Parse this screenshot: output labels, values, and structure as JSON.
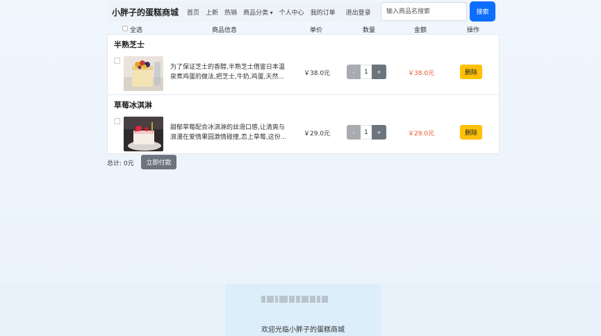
{
  "nav": {
    "brand": "小胖子的蛋糕商城",
    "links": [
      "首页",
      "上新",
      "热销"
    ],
    "category": "商品分类",
    "links2": [
      "个人中心",
      "我的订单"
    ],
    "logout": "退出登录",
    "search_placeholder": "输入商品名搜索",
    "search_button": "搜索"
  },
  "table_header": {
    "select_all": "全选",
    "product_info": "商品信息",
    "unit_price": "单价",
    "quantity": "数量",
    "amount": "金额",
    "actions": "操作"
  },
  "items": [
    {
      "title": "半熟芝士",
      "desc_line1": "为了保证芝士的香醇,半熟芝士借鉴日本温",
      "desc_line2": "泉煮鸡蛋的做法,把芝士,牛奶,鸡蛋,天然...",
      "price": "￥38.0元",
      "qty_minus": "-",
      "qty": "1",
      "qty_plus": "+",
      "amount": "￥38.0元",
      "delete": "删除"
    },
    {
      "title": "草莓冰淇淋",
      "desc_line1": "甜郁草莓配合冰淇淋的丝滑口感,让清爽与",
      "desc_line2": "浪漫在爱情果园激情碰撞,恋上草莓,这份...",
      "price": "￥29.0元",
      "qty_minus": "-",
      "qty": "1",
      "qty_plus": "+",
      "amount": "￥29.0元",
      "delete": "删除"
    }
  ],
  "total": {
    "label": "总计:  0元",
    "pay_button": "立即付款"
  },
  "footer": {
    "welcome": "欢迎光临小胖子的蛋糕商城"
  },
  "colors": {
    "primary": "#0d6efd",
    "warning": "#ffc107",
    "secondary": "#6c757d",
    "amount": "#e8562a"
  }
}
